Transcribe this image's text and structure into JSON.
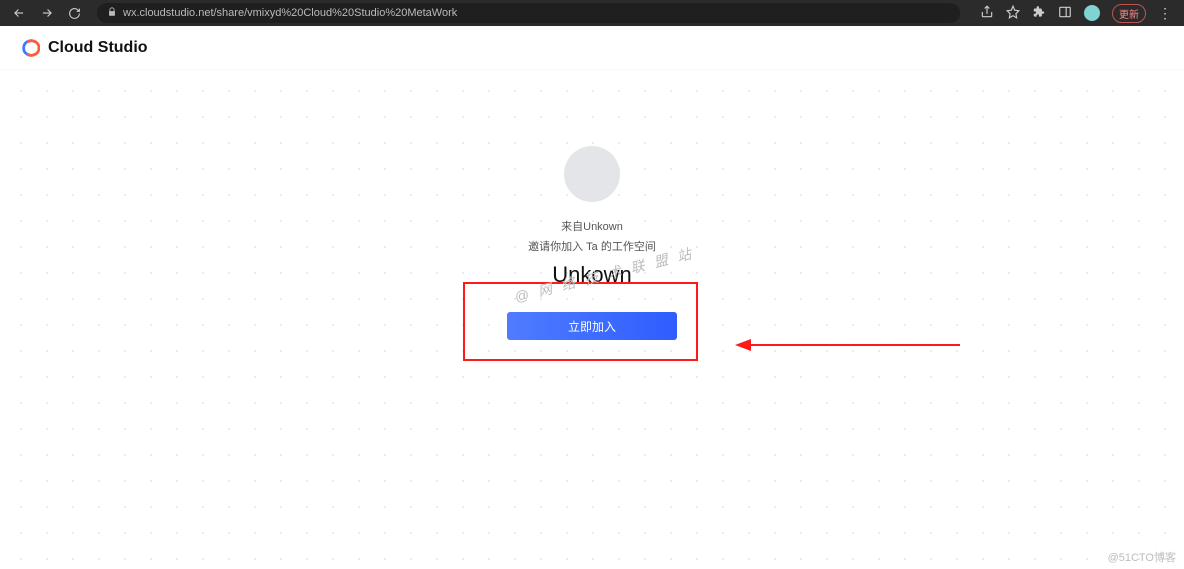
{
  "browser": {
    "url": "wx.cloudstudio.net/share/vmixyd%20Cloud%20Studio%20MetaWork",
    "update_label": "更新"
  },
  "header": {
    "brand": "Cloud Studio"
  },
  "invite": {
    "from_text": "来自Unkown",
    "invite_text": "邀请你加入 Ta 的工作空间",
    "workspace_name": "Unkown",
    "join_label": "立即加入"
  },
  "watermarks": {
    "center": "@ 网 络 技 术 联 盟 站",
    "bottom_right": "@51CTO博客"
  }
}
